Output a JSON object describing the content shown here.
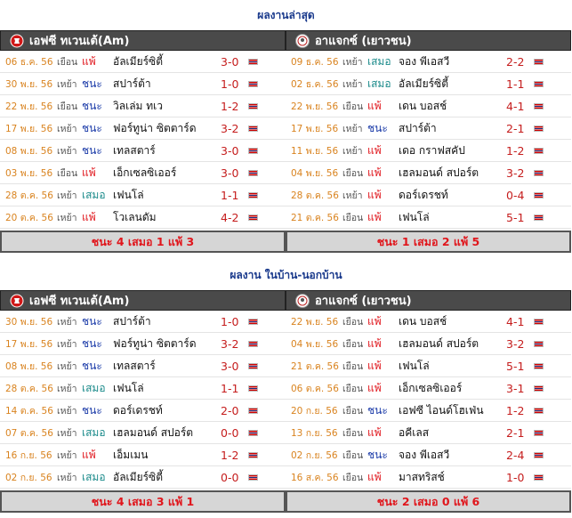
{
  "sections": [
    {
      "title": "ผลงานล่าสุด",
      "left": {
        "team": "เอฟซี ทเวนเต้(Am)",
        "crest": "twente-crest-icon",
        "summary": "ชนะ 4 เสมอ 1 แพ้ 3",
        "rows": [
          {
            "date": "06 ธ.ค. 56",
            "ha": "เยือน",
            "res": "แพ้",
            "rc": "lose",
            "opp": "อัลเมียร์ซิตี้",
            "score": "3-0"
          },
          {
            "date": "30 พ.ย. 56",
            "ha": "เหย้า",
            "res": "ชนะ",
            "rc": "win",
            "opp": "สปาร์ต้า",
            "score": "1-0"
          },
          {
            "date": "22 พ.ย. 56",
            "ha": "เยือน",
            "res": "ชนะ",
            "rc": "win",
            "opp": "วิลเล่ม ทเว",
            "score": "1-2"
          },
          {
            "date": "17 พ.ย. 56",
            "ha": "เหย้า",
            "res": "ชนะ",
            "rc": "win",
            "opp": "ฟอร์ทูน่า ซิตตาร์ด",
            "score": "3-2"
          },
          {
            "date": "08 พ.ย. 56",
            "ha": "เหย้า",
            "res": "ชนะ",
            "rc": "win",
            "opp": "เทลสตาร์",
            "score": "3-0"
          },
          {
            "date": "03 พ.ย. 56",
            "ha": "เยือน",
            "res": "แพ้",
            "rc": "lose",
            "opp": "เอ็กเซลซิเออร์",
            "score": "3-0"
          },
          {
            "date": "28 ต.ค. 56",
            "ha": "เหย้า",
            "res": "เสมอ",
            "rc": "draw",
            "opp": "เฟนโล่",
            "score": "1-1"
          },
          {
            "date": "20 ต.ค. 56",
            "ha": "เหย้า",
            "res": "แพ้",
            "rc": "lose",
            "opp": "โวเลนดัม",
            "score": "4-2"
          }
        ]
      },
      "right": {
        "team": "อาแจกซ์ (เยาวชน)",
        "crest": "ajax-crest-icon",
        "summary": "ชนะ 1 เสมอ 2 แพ้ 5",
        "rows": [
          {
            "date": "09 ธ.ค. 56",
            "ha": "เหย้า",
            "res": "เสมอ",
            "rc": "draw",
            "opp": "จอง พีเอสวี",
            "score": "2-2"
          },
          {
            "date": "02 ธ.ค. 56",
            "ha": "เหย้า",
            "res": "เสมอ",
            "rc": "draw",
            "opp": "อัลเมียร์ซิตี้",
            "score": "1-1"
          },
          {
            "date": "22 พ.ย. 56",
            "ha": "เยือน",
            "res": "แพ้",
            "rc": "lose",
            "opp": "เดน บอสช์",
            "score": "4-1"
          },
          {
            "date": "17 พ.ย. 56",
            "ha": "เหย้า",
            "res": "ชนะ",
            "rc": "win",
            "opp": "สปาร์ต้า",
            "score": "2-1"
          },
          {
            "date": "11 พ.ย. 56",
            "ha": "เหย้า",
            "res": "แพ้",
            "rc": "lose",
            "opp": "เดอ กราฟสคัป",
            "score": "1-2"
          },
          {
            "date": "04 พ.ย. 56",
            "ha": "เยือน",
            "res": "แพ้",
            "rc": "lose",
            "opp": "เฮลมอนด์ สปอร์ต",
            "score": "3-2"
          },
          {
            "date": "28 ต.ค. 56",
            "ha": "เหย้า",
            "res": "แพ้",
            "rc": "lose",
            "opp": "ดอร์เดรชท์",
            "score": "0-4"
          },
          {
            "date": "21 ต.ค. 56",
            "ha": "เยือน",
            "res": "แพ้",
            "rc": "lose",
            "opp": "เฟนโล่",
            "score": "5-1"
          }
        ]
      }
    },
    {
      "title": "ผลงาน ในบ้าน-นอกบ้าน",
      "left": {
        "team": "เอฟซี ทเวนเต้(Am)",
        "crest": "twente-crest-icon",
        "summary": "ชนะ 4 เสมอ 3 แพ้ 1",
        "rows": [
          {
            "date": "30 พ.ย. 56",
            "ha": "เหย้า",
            "res": "ชนะ",
            "rc": "win",
            "opp": "สปาร์ต้า",
            "score": "1-0"
          },
          {
            "date": "17 พ.ย. 56",
            "ha": "เหย้า",
            "res": "ชนะ",
            "rc": "win",
            "opp": "ฟอร์ทูน่า ซิตตาร์ด",
            "score": "3-2"
          },
          {
            "date": "08 พ.ย. 56",
            "ha": "เหย้า",
            "res": "ชนะ",
            "rc": "win",
            "opp": "เทลสตาร์",
            "score": "3-0"
          },
          {
            "date": "28 ต.ค. 56",
            "ha": "เหย้า",
            "res": "เสมอ",
            "rc": "draw",
            "opp": "เฟนโล่",
            "score": "1-1"
          },
          {
            "date": "14 ต.ค. 56",
            "ha": "เหย้า",
            "res": "ชนะ",
            "rc": "win",
            "opp": "ดอร์เดรชท์",
            "score": "2-0"
          },
          {
            "date": "07 ต.ค. 56",
            "ha": "เหย้า",
            "res": "เสมอ",
            "rc": "draw",
            "opp": "เฮลมอนด์ สปอร์ต",
            "score": "0-0"
          },
          {
            "date": "16 ก.ย. 56",
            "ha": "เหย้า",
            "res": "แพ้",
            "rc": "lose",
            "opp": "เอ็มเมน",
            "score": "1-2"
          },
          {
            "date": "02 ก.ย. 56",
            "ha": "เหย้า",
            "res": "เสมอ",
            "rc": "draw",
            "opp": "อัลเมียร์ซิตี้",
            "score": "0-0"
          }
        ]
      },
      "right": {
        "team": "อาแจกซ์ (เยาวชน)",
        "crest": "ajax-crest-icon",
        "summary": "ชนะ 2 เสมอ 0 แพ้ 6",
        "rows": [
          {
            "date": "22 พ.ย. 56",
            "ha": "เยือน",
            "res": "แพ้",
            "rc": "lose",
            "opp": "เดน บอสช์",
            "score": "4-1"
          },
          {
            "date": "04 พ.ย. 56",
            "ha": "เยือน",
            "res": "แพ้",
            "rc": "lose",
            "opp": "เฮลมอนด์ สปอร์ต",
            "score": "3-2"
          },
          {
            "date": "21 ต.ค. 56",
            "ha": "เยือน",
            "res": "แพ้",
            "rc": "lose",
            "opp": "เฟนโล่",
            "score": "5-1"
          },
          {
            "date": "06 ต.ค. 56",
            "ha": "เยือน",
            "res": "แพ้",
            "rc": "lose",
            "opp": "เอ็กเซลซิเออร์",
            "score": "3-1"
          },
          {
            "date": "20 ก.ย. 56",
            "ha": "เยือน",
            "res": "ชนะ",
            "rc": "win",
            "opp": "เอฟซี ไอนด์โฮเฟ่น",
            "score": "1-2"
          },
          {
            "date": "13 ก.ย. 56",
            "ha": "เยือน",
            "res": "แพ้",
            "rc": "lose",
            "opp": "อคีเลส",
            "score": "2-1"
          },
          {
            "date": "02 ก.ย. 56",
            "ha": "เยือน",
            "res": "ชนะ",
            "rc": "win",
            "opp": "จอง พีเอสวี",
            "score": "2-4"
          },
          {
            "date": "16 ส.ค. 56",
            "ha": "เยือน",
            "res": "แพ้",
            "rc": "lose",
            "opp": "มาสทริสช์",
            "score": "1-0"
          }
        ]
      }
    }
  ],
  "colors": {
    "win": "#1a3aa8",
    "draw": "#1a8a8a",
    "lose": "#e0161c",
    "date": "#d9831f",
    "score": "#c51d1d",
    "title": "#1a3a8c"
  }
}
